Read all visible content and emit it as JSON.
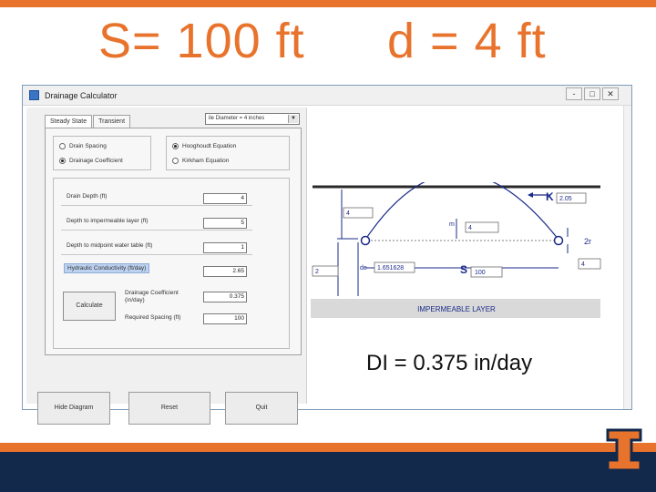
{
  "slide": {
    "title_spacing": "S= 100 ft",
    "title_depth": "d = 4 ft",
    "result": "DI = 0.375 in/day"
  },
  "colors": {
    "accent": "#e8732c",
    "navy": "#13294b",
    "diagram_blue": "#1a2a8a"
  },
  "window": {
    "title": "Drainage Calculator",
    "buttons": {
      "minimize": "-",
      "maximize": "□",
      "close": "✕"
    }
  },
  "tabs": [
    {
      "label": "Steady State"
    },
    {
      "label": "Transient"
    }
  ],
  "pipe_select": {
    "value": "ile Diameter = 4 inches"
  },
  "mode_group": {
    "drain_spacing": "Drain Spacing",
    "drainage_coefficient": "Drainage Coefficient"
  },
  "equation_group": {
    "hooghoudt": "Hooghoudt Equation",
    "kirkham": "Kirkham Equation"
  },
  "fields": [
    {
      "label": "Drain Depth (ft)",
      "value": "4"
    },
    {
      "label": "Depth to impermeable layer (ft)",
      "value": "5"
    },
    {
      "label": "Depth to midpoint water table (ft)",
      "value": "1"
    },
    {
      "label": "Hydraulic Conductivity (ft/day)",
      "value": "2.65"
    }
  ],
  "outputs": {
    "calculate": "Calculate",
    "dc_label_1": "Drainage Coefficient",
    "dc_label_2": "(in/day)",
    "dc_value": "0.375",
    "spacing_label": "Required Spacing (ft)",
    "spacing_value": "100"
  },
  "bottom_buttons": {
    "diagram": "Hide Diagram",
    "reset": "Reset",
    "quit": "Quit"
  },
  "diagram": {
    "k_label": "K",
    "k_value": "2.05",
    "h_left": "4",
    "m_label": "m",
    "m_value": "4",
    "r_label": "2r",
    "right_value": "4",
    "d_left": "2",
    "de_label": "de",
    "de_value": "1.651628",
    "s_label": "S",
    "s_value": "100",
    "layer_label": "IMPERMEABLE LAYER"
  }
}
